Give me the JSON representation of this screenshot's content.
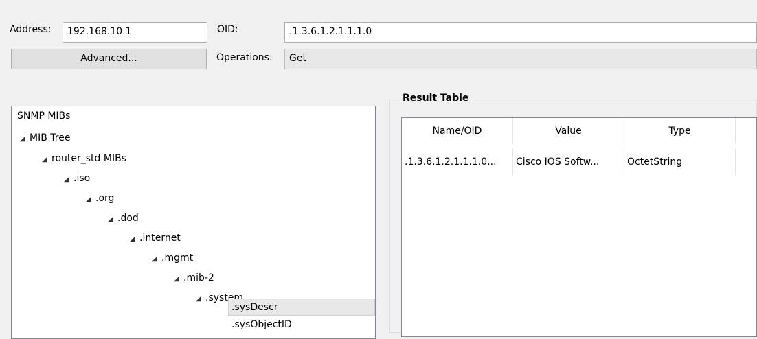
{
  "form": {
    "address_label": "Address:",
    "address_value": "192.168.10.1",
    "oid_label": "OID:",
    "oid_value": ".1.3.6.1.2.1.1.1.0",
    "advanced_button": "Advanced...",
    "operations_label": "Operations:",
    "operations_value": "Get"
  },
  "mib_panel": {
    "header": "SNMP MIBs",
    "nodes": [
      {
        "label": "MIB Tree",
        "expanded": true
      },
      {
        "label": "router_std MIBs",
        "expanded": true
      },
      {
        "label": ".iso",
        "expanded": true
      },
      {
        "label": ".org",
        "expanded": true
      },
      {
        "label": ".dod",
        "expanded": true
      },
      {
        "label": ".internet",
        "expanded": true
      },
      {
        "label": ".mgmt",
        "expanded": true
      },
      {
        "label": ".mib-2",
        "expanded": true
      },
      {
        "label": ".system",
        "expanded": true
      },
      {
        "label": ".sysDescr",
        "selected": true
      },
      {
        "label": ".sysObjectID"
      }
    ]
  },
  "result": {
    "title": "Result Table",
    "columns": [
      "Name/OID",
      "Value",
      "Type"
    ],
    "rows": [
      {
        "oid": ".1.3.6.1.2.1.1.1.0...",
        "value": "Cisco IOS Softw...",
        "type": "OctetString"
      }
    ]
  },
  "icons": {
    "expanded": "expanded-triangle-icon"
  }
}
